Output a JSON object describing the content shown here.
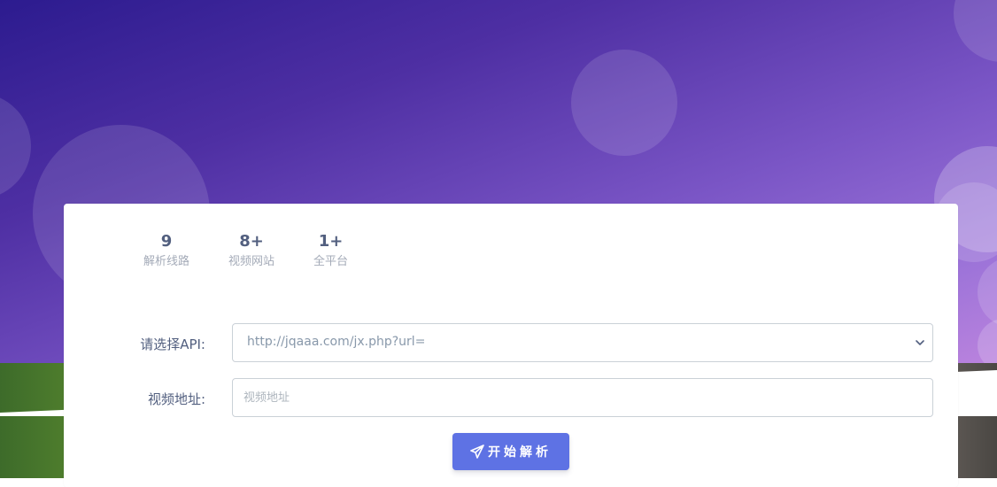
{
  "stats": [
    {
      "value": "9",
      "label": "解析线路"
    },
    {
      "value": "8+",
      "label": "视频网站"
    },
    {
      "value": "1+",
      "label": "全平台"
    }
  ],
  "form": {
    "api_label": "请选择API:",
    "api_selected": "http://jqaaa.com/jx.php?url=",
    "url_label": "视频地址:",
    "url_placeholder": "视频地址",
    "url_value": ""
  },
  "button": {
    "label": "开始解析",
    "icon": "paper-plane-icon"
  },
  "colors": {
    "primary": "#5e72e4",
    "text": "#525f7f",
    "muted": "#a4abb8"
  }
}
